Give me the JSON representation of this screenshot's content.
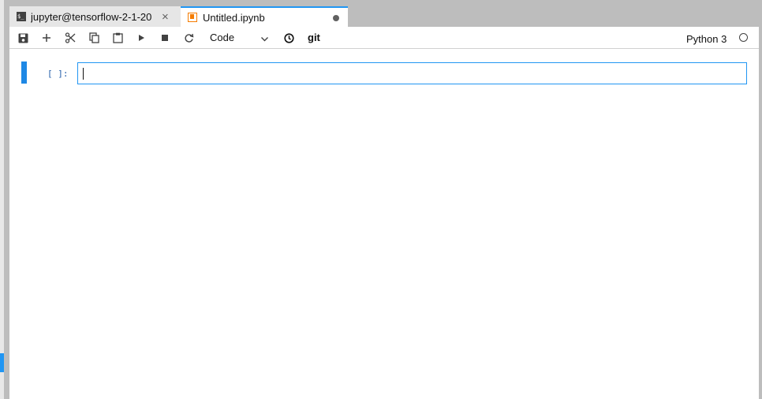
{
  "tabs": [
    {
      "label": "jupyter@tensorflow-2-1-20",
      "icon": "terminal-icon",
      "close": "×"
    },
    {
      "label": "Untitled.ipynb",
      "icon": "notebook-icon"
    }
  ],
  "terminal_icon_text": "$_",
  "toolbar": {
    "buttons": [
      "save-icon",
      "add-cell-icon",
      "cut-icon",
      "copy-icon",
      "paste-icon",
      "run-icon",
      "stop-icon",
      "restart-icon"
    ],
    "cell_type": "Code",
    "clock_icon": "clock-icon",
    "git": "git",
    "kernel_name": "Python 3",
    "kernel_status": "idle"
  },
  "cell": {
    "prompt": "[ ]:",
    "input": ""
  },
  "colors": {
    "accent": "#2196f3",
    "notebook_icon": "#f57c00",
    "tabbar_bg": "#bdbdbd"
  }
}
